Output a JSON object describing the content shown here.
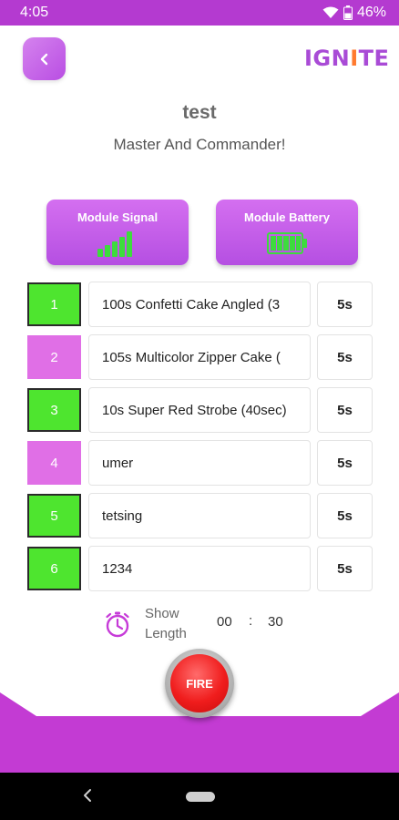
{
  "status_bar": {
    "time": "4:05",
    "battery_percent": "46%"
  },
  "header": {
    "back_icon": "chevron-left-icon",
    "logo_text_left": "IGN",
    "logo_text_accent": "I",
    "logo_text_right": "TE"
  },
  "show": {
    "title": "test",
    "subtitle": "Master And Commander!"
  },
  "modules": {
    "signal": {
      "label": "Module Signal",
      "bars": 5,
      "color": "#3ddc3d"
    },
    "battery": {
      "label": "Module Battery",
      "level": 1.0,
      "color": "#3ddc3d"
    }
  },
  "cues": [
    {
      "number": "1",
      "name": "100s Confetti Cake Angled (3",
      "duration": "5s",
      "active": true
    },
    {
      "number": "2",
      "name": "105s Multicolor Zipper Cake (",
      "duration": "5s",
      "active": false
    },
    {
      "number": "3",
      "name": "10s Super Red Strobe (40sec)",
      "duration": "5s",
      "active": true
    },
    {
      "number": "4",
      "name": "umer",
      "duration": "5s",
      "active": false
    },
    {
      "number": "5",
      "name": "tetsing",
      "duration": "5s",
      "active": true
    },
    {
      "number": "6",
      "name": "1234",
      "duration": "5s",
      "active": true
    }
  ],
  "show_length": {
    "label": "Show Length",
    "minutes": "00",
    "separator": ":",
    "seconds": "30"
  },
  "fire_button": {
    "label": "FIRE"
  },
  "colors": {
    "accent": "#b43ad0",
    "active_cue": "#4ee52f",
    "inactive_cue": "#e06fe6",
    "fire": "#f01d1d"
  }
}
